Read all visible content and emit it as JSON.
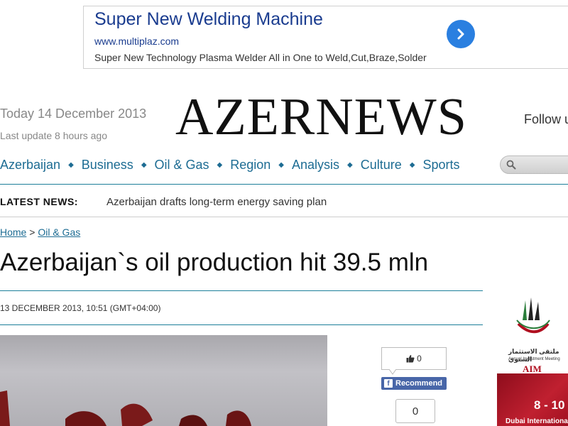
{
  "ad": {
    "title": "Super New Welding Machine",
    "url": "www.multiplaz.com",
    "description": "Super New Technology Plasma Welder All in One to Weld,Cut,Braze,Solder",
    "arrow_icon": "chevron-right-icon",
    "accent": "#2a7fe0"
  },
  "header": {
    "today": "Today 14 December 2013",
    "last_update": "Last update 8 hours ago",
    "logo": "AZERNEWS",
    "follow": "Follow u"
  },
  "nav": {
    "items": [
      "Azerbaijan",
      "Business",
      "Oil & Gas",
      "Region",
      "Analysis",
      "Culture",
      "Sports"
    ],
    "separator": "◆",
    "color": "#1d6c93"
  },
  "search": {
    "icon": "search-icon",
    "placeholder": ""
  },
  "latest_news": {
    "label": "LATEST NEWS:",
    "headline": "Azerbaijan drafts long-term energy saving plan"
  },
  "breadcrumb": {
    "home": "Home",
    "separator": ">",
    "section": "Oil & Gas"
  },
  "article": {
    "title": "Azerbaijan`s oil production hit 39.5 mln",
    "dateline": "13 DECEMBER 2013, 10:51 (GMT+04:00)"
  },
  "social": {
    "like_icon": "thumbs-up-icon",
    "like_count": "0",
    "recommend_label": "Recommend",
    "facebook_icon": "facebook-icon",
    "share_count": "0"
  },
  "side_ad": {
    "arabic": "ملتقى الاستثمار السنوي",
    "annual": "Annual Investment Meeting",
    "brand": "AIM",
    "dates": "8 - 10",
    "venue": "Dubai International"
  }
}
